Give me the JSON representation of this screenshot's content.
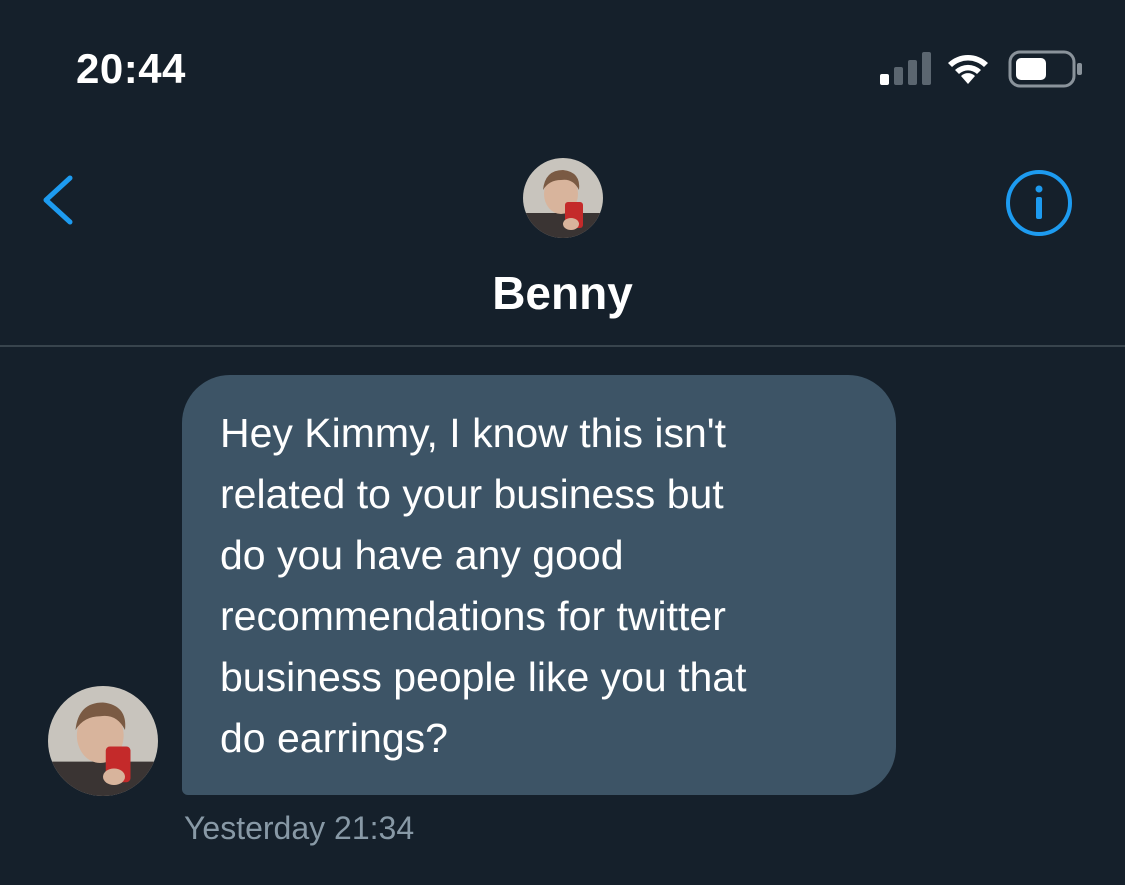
{
  "status_bar": {
    "time": "20:44",
    "signal_icon": "cellular-signal-icon",
    "wifi_icon": "wifi-icon",
    "battery_icon": "battery-icon"
  },
  "header": {
    "back_icon": "chevron-left-icon",
    "info_icon": "info-circle-icon",
    "contact_name": "Benny",
    "accent_color": "#1d9bf0"
  },
  "conversation": {
    "messages": [
      {
        "text": "Hey Kimmy, I know this isn't\nrelated to your business but\ndo you have any good\nrecommendations for twitter\nbusiness people like you that\ndo earrings?",
        "timestamp": "Yesterday 21:34",
        "bubble_color": "#3d5466"
      }
    ]
  },
  "colors": {
    "background": "#15202b",
    "divider": "#38444d",
    "muted_text": "#8899a6"
  }
}
